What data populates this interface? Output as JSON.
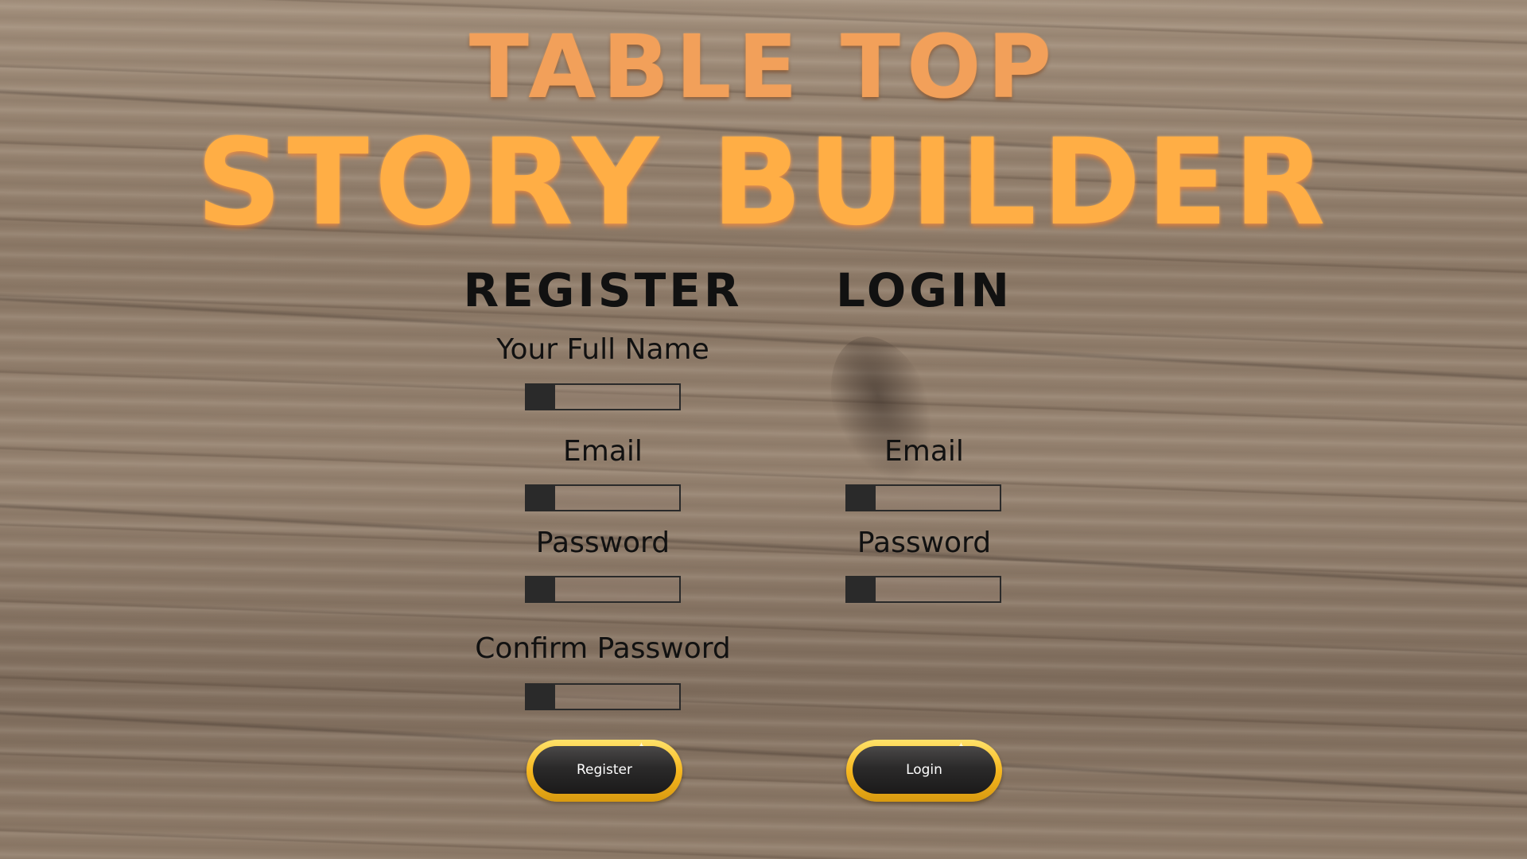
{
  "title": {
    "top": "TABLE TOP",
    "main": "STORY BUILDER"
  },
  "register": {
    "heading": "REGISTER",
    "full_name_label": "Your Full Name",
    "email_label": "Email",
    "password_label": "Password",
    "confirm_password_label": "Confirm Password",
    "button_label": "Register"
  },
  "login": {
    "heading": "LOGIN",
    "email_label": "Email",
    "password_label": "Password",
    "button_label": "Login"
  },
  "colors": {
    "title_top": "#f2a05a",
    "title_main": "#ffae45",
    "heading": "#111111",
    "button_rim": "#f7b820",
    "button_core": "#2b2a2a"
  }
}
